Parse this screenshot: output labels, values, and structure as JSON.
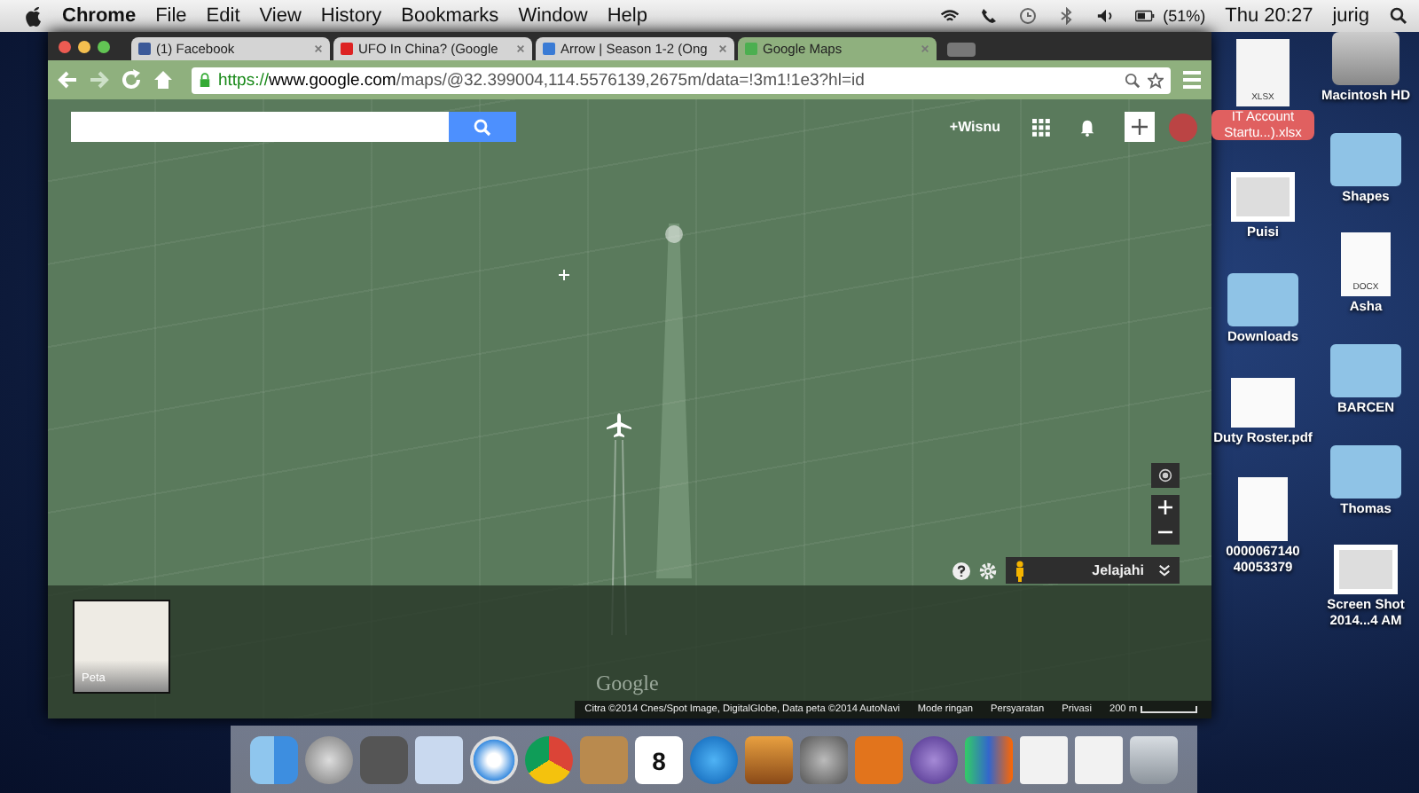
{
  "menubar": {
    "app": "Chrome",
    "menus": [
      "File",
      "Edit",
      "View",
      "History",
      "Bookmarks",
      "Window",
      "Help"
    ],
    "battery": "(51%)",
    "clock": "Thu 20:27",
    "user": "jurig"
  },
  "browser": {
    "tabs": [
      {
        "title": "(1) Facebook",
        "kind": "facebook",
        "selected": false
      },
      {
        "title": "UFO In China? (Google",
        "kind": "video",
        "selected": false
      },
      {
        "title": "Arrow | Season 1-2 (Ong",
        "kind": "arrow",
        "selected": false
      },
      {
        "title": "Google Maps",
        "kind": "maps",
        "selected": true
      }
    ],
    "url": {
      "scheme": "https://",
      "host": "www.google.com",
      "path": "/maps/@32.399004,114.5576139,2675m/data=!3m1!1e3?hl=id"
    }
  },
  "maps": {
    "user": "+Wisnu",
    "explore": "Jelajahi",
    "thumbnail": "Peta",
    "logo": "Google",
    "footer": [
      "Citra ©2014 Cnes/Spot Image, DigitalGlobe, Data peta ©2014 AutoNavi",
      "Mode ringan",
      "Persyaratan",
      "Privasi"
    ],
    "scale": "200 m"
  },
  "desktop": {
    "columns": [
      {
        "items": [
          {
            "label": "IT Account Startu...).xlsx",
            "kind": "sheet",
            "badge": "XLSX",
            "selected": true
          },
          {
            "label": "Puisi",
            "kind": "image",
            "selected": false
          },
          {
            "label": "Downloads",
            "kind": "folder",
            "selected": false
          },
          {
            "label": "Duty Roster.pdf",
            "kind": "pdf",
            "selected": false
          },
          {
            "label": "0000067140 40053379",
            "kind": "doc",
            "selected": false
          }
        ]
      },
      {
        "items": [
          {
            "label": "Macintosh HD",
            "kind": "disk",
            "selected": false
          },
          {
            "label": "Shapes",
            "kind": "folder",
            "selected": false
          },
          {
            "label": "Asha",
            "kind": "doc",
            "badge": "DOCX",
            "selected": false
          },
          {
            "label": "BARCEN",
            "kind": "folder",
            "selected": false
          },
          {
            "label": "Thomas",
            "kind": "folder",
            "selected": false
          },
          {
            "label": "Screen Shot 2014...4 AM",
            "kind": "image",
            "selected": false
          }
        ]
      }
    ]
  },
  "dock": [
    {
      "kind": "finder"
    },
    {
      "kind": "launchpad"
    },
    {
      "kind": "photos"
    },
    {
      "kind": "mail"
    },
    {
      "kind": "safari"
    },
    {
      "kind": "chrome"
    },
    {
      "kind": "contacts"
    },
    {
      "kind": "calendar",
      "text": "8"
    },
    {
      "kind": "itunes"
    },
    {
      "kind": "iphoto"
    },
    {
      "kind": "prefs"
    },
    {
      "kind": "keynote"
    },
    {
      "kind": "script"
    },
    {
      "kind": "numbers"
    },
    {
      "kind": "doc"
    },
    {
      "kind": "doc"
    },
    {
      "kind": "trash"
    }
  ]
}
